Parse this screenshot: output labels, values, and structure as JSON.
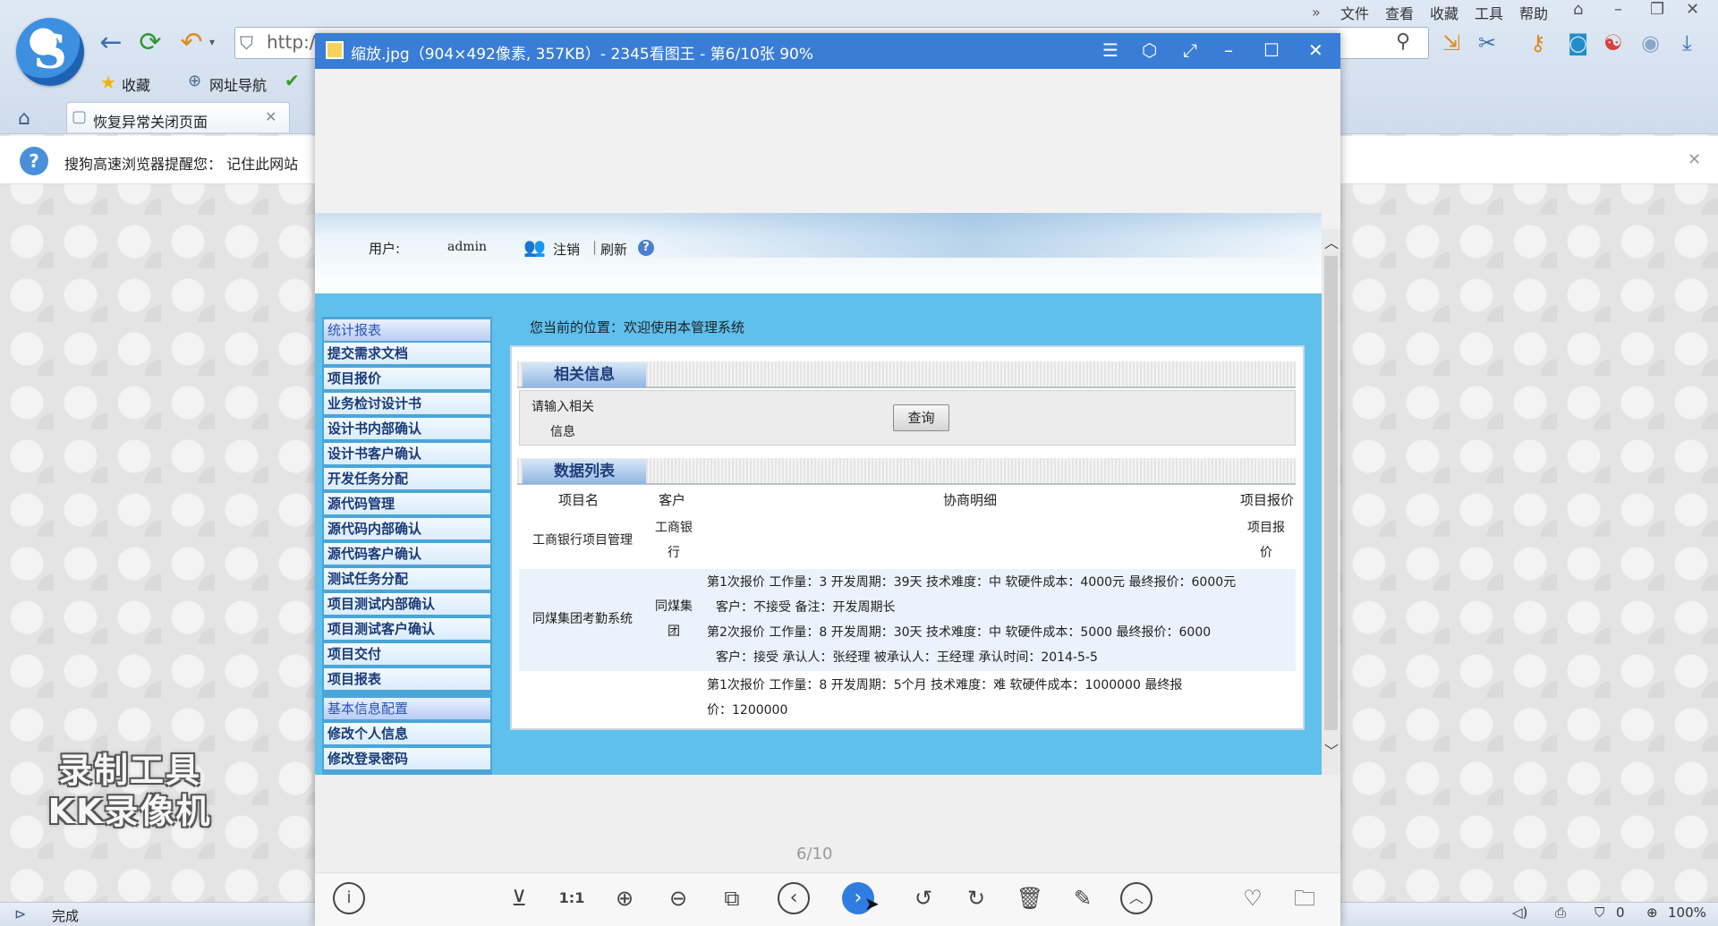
{
  "browser": {
    "logo_letter": "S",
    "menu": [
      "文件",
      "查看",
      "收藏",
      "工具",
      "帮助"
    ],
    "address_text": "http:/",
    "favorites_label": "收藏",
    "nav_site_label": "网址导航",
    "tab_label": "恢复异常关闭页面",
    "notice_text": "搜狗高速浏览器提醒您：  记住此网站",
    "status_text": "完成",
    "status_zoom": "100%",
    "status_count": "0"
  },
  "watermark": {
    "line1": "录制工具",
    "line2": "KK录像机"
  },
  "viewer": {
    "title": "缩放.jpg（904×492像素, 357KB）- 2345看图王 - 第6/10张 90%",
    "counter": "6/10"
  },
  "embed": {
    "header": {
      "user_label": "用户:",
      "user_value": "admin",
      "logout": "注销",
      "separator": "|",
      "refresh": "刷新",
      "help": "?"
    },
    "breadcrumb": "您当前的位置：欢迎使用本管理系统",
    "sidebar": {
      "group1_title": "统计报表",
      "group1_items": [
        "提交需求文档",
        "项目报价",
        "业务检讨设计书",
        "设计书内部确认",
        "设计书客户确认",
        "开发任务分配",
        "源代码管理",
        "源代码内部确认",
        "源代码客户确认",
        "测试任务分配",
        "项目测试内部确认",
        "项目测试客户确认",
        "项目交付",
        "项目报表"
      ],
      "group2_title": "基本信息配置",
      "group2_items": [
        "修改个人信息",
        "修改登录密码"
      ]
    },
    "info_section": {
      "title": "相关信息",
      "search_label": "请输入相关信息",
      "search_value": "",
      "search_button": "查询"
    },
    "list_section": {
      "title": "数据列表",
      "columns": [
        "项目名",
        "客户",
        "协商明细",
        "项目报价"
      ],
      "rows": [
        {
          "name": "工商银行项目管理",
          "client": "工商银行",
          "detail": [],
          "quote": "项目报价"
        },
        {
          "name": "同煤集团考勤系统",
          "client": "同煤集团",
          "detail": [
            "第1次报价  工作量：3 开发周期：39天 技术难度：中 软硬件成本：4000元 最终报价：6000元",
            "客户：不接受 备注：开发周期长",
            "第2次报价  工作量：8 开发周期：30天 技术难度：中 软硬件成本：5000 最终报价：6000",
            "客户：接受 承认人：张经理 被承认人：王经理 承认时间：2014-5-5"
          ],
          "quote": ""
        },
        {
          "name": "",
          "client": "",
          "detail": [
            "第1次报价  工作量：8 开发周期：5个月 技术难度：难 软硬件成本：1000000 最终报价：1200000"
          ],
          "quote": ""
        }
      ]
    }
  }
}
